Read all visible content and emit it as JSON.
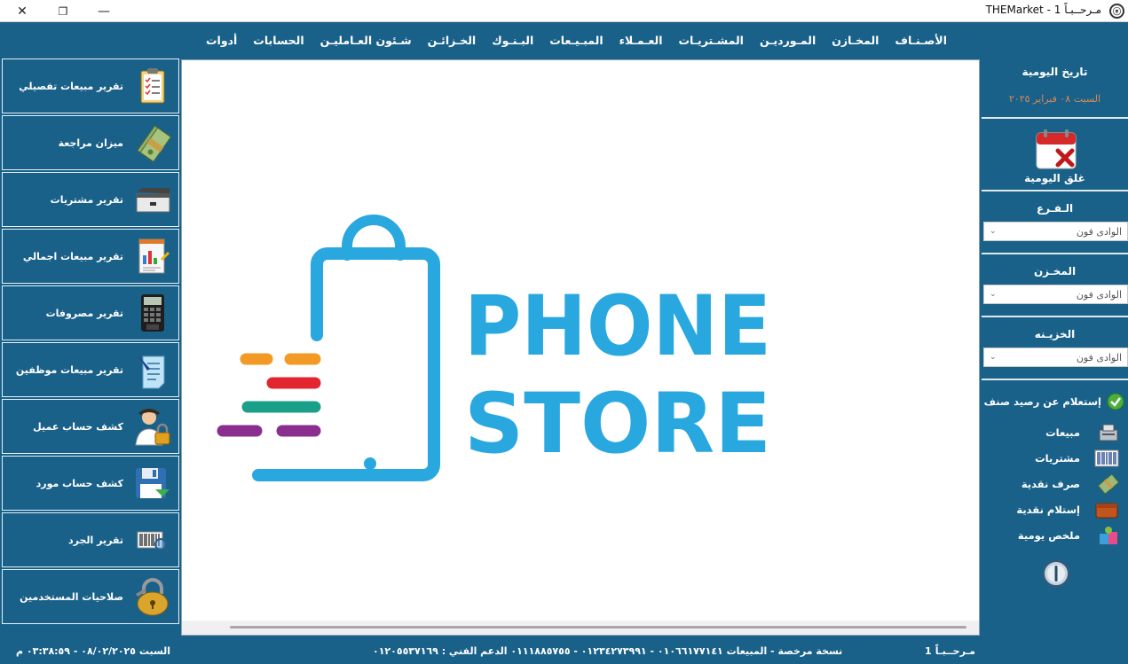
{
  "window": {
    "title": "THEMarket  - مـرحــبـاً 1",
    "app_icon": "ⓔ",
    "close_icon": "✕",
    "restore_icon": "❐",
    "minimize_icon": "—"
  },
  "menu": [
    "الأصـنـاف",
    "المخـازن",
    "المـورديـن",
    "المشـتريـات",
    "العـمـلاء",
    "المبـيـعات",
    "البـنـوك",
    "الخـزائـن",
    "شـئون العـامليـن",
    "الحسابات",
    "أدوات"
  ],
  "left_buttons": [
    {
      "label": "تقرير مبيعات تفصيلي",
      "icon": "clipboard-icon"
    },
    {
      "label": "ميزان مراجعة",
      "icon": "money-stack-icon"
    },
    {
      "label": "تقرير مشتريات",
      "icon": "cash-drawer-icon"
    },
    {
      "label": "تقرير مبيعات اجمالي",
      "icon": "report-chart-icon"
    },
    {
      "label": "تقرير مصروفات",
      "icon": "calculator-icon"
    },
    {
      "label": "تقرير مبيعات موظفين",
      "icon": "checklist-pen-icon"
    },
    {
      "label": "كشف حساب عميل",
      "icon": "user-lock-icon"
    },
    {
      "label": "كشف حساب مورد",
      "icon": "floppy-disk-icon"
    },
    {
      "label": "تقرير الجرد",
      "icon": "barcode-search-icon"
    },
    {
      "label": "صلاحيات المستخدمين",
      "icon": "padlock-icon"
    }
  ],
  "logo": {
    "line1": "PHONE",
    "line2": "STORE",
    "color": "#29a8e0"
  },
  "right": {
    "daily_title": "تاريخ اليومية",
    "daily_date": "السبت ٠٨ فبراير ٢٠٢٥",
    "close_daily_label": "غلق اليومية",
    "branch_label": "الـفـرع",
    "branch_value": "الوادى فون",
    "store_label": "المخـزن",
    "store_value": "الوادى فون",
    "treasury_label": "الخزيـنه",
    "treasury_value": "الوادى فون",
    "actions": [
      {
        "label": "إستعلام عن رصيد صنف",
        "icon": "check-circle-icon"
      },
      {
        "label": "مبيعات",
        "icon": "cash-register-icon"
      },
      {
        "label": "مشتريات",
        "icon": "barcode-icon"
      },
      {
        "label": "صرف نقدية",
        "icon": "money-out-icon"
      },
      {
        "label": "إستلام نقدية",
        "icon": "wallet-icon"
      },
      {
        "label": "ملخص يومية",
        "icon": "summary-bags-icon"
      }
    ]
  },
  "status": {
    "user": "مـرحــبـاً",
    "user_number": "1",
    "license": "نسخة مرخصة - المبيعات ٠١٠٦٦١٧٧١٤١ - ٠١٢٣٤٢٧٣٩٩١ - ٠١١١٨٨٥٧٥٥ الدعم الفني : ٠١٢٠٥٥٣٧١٦٩",
    "datetime": "السبت ٠٨/٠٢/٢٠٢٥ - ٠٣:٣٨:٥٩ م"
  },
  "colors": {
    "primary": "#1a6189",
    "logo_blue": "#29a8e0",
    "stripe_orange": "#f29a25",
    "stripe_red": "#e32530",
    "stripe_teal": "#1aa08a",
    "stripe_purple": "#8a2f8f",
    "date_orange": "#d98a55"
  }
}
